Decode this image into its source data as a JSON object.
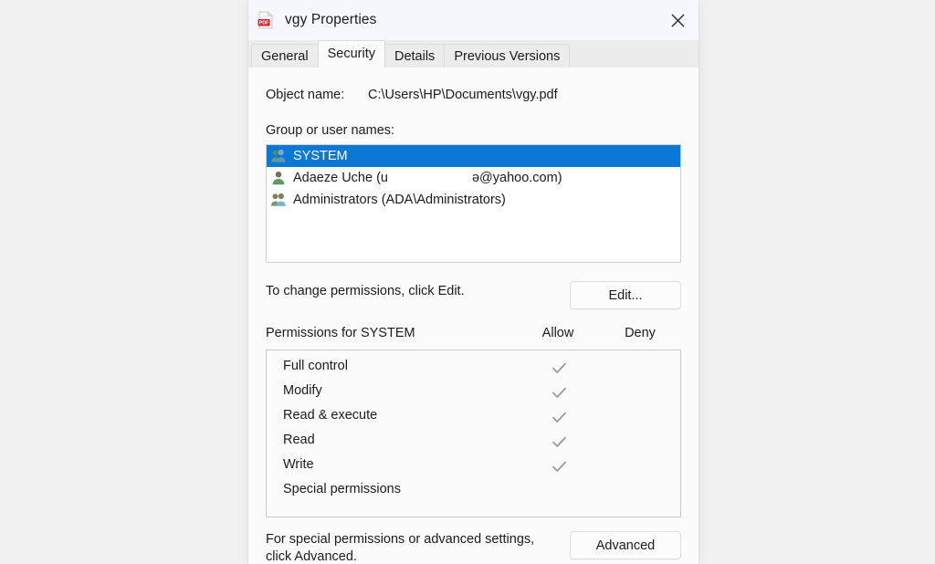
{
  "window": {
    "title": "vgy Properties",
    "icon": "pdf-file-icon",
    "close_label": "✕"
  },
  "tabs": [
    {
      "label": "General",
      "active": false
    },
    {
      "label": "Security",
      "active": true
    },
    {
      "label": "Details",
      "active": false
    },
    {
      "label": "Previous Versions",
      "active": false
    }
  ],
  "security": {
    "object_name_label": "Object name:",
    "object_name_value": "C:\\Users\\HP\\Documents\\vgy.pdf",
    "group_label": "Group or user names:",
    "users": [
      {
        "name": "SYSTEM",
        "icon": "group-users-icon",
        "selected": true
      },
      {
        "name_before": "Adaeze Uche (u",
        "name_after": "ə@yahoo.com)",
        "icon": "single-user-icon",
        "selected": false,
        "redacted": true
      },
      {
        "name": "Administrators (ADA\\Administrators)",
        "icon": "group-users-icon",
        "selected": false
      }
    ],
    "edit_hint": "To change permissions, click Edit.",
    "edit_button": "Edit...",
    "permissions_for": "Permissions for SYSTEM",
    "allow_header": "Allow",
    "deny_header": "Deny",
    "permissions": [
      {
        "name": "Full control",
        "allow": true,
        "deny": false
      },
      {
        "name": "Modify",
        "allow": true,
        "deny": false
      },
      {
        "name": "Read & execute",
        "allow": true,
        "deny": false
      },
      {
        "name": "Read",
        "allow": true,
        "deny": false
      },
      {
        "name": "Write",
        "allow": true,
        "deny": false
      },
      {
        "name": "Special permissions",
        "allow": false,
        "deny": false
      }
    ],
    "footer_hint": "For special permissions or advanced settings, click Advanced.",
    "advanced_button": "Advanced"
  },
  "colors": {
    "selection_blue": "#0a78d4",
    "check_gray": "#9a9a9a",
    "dialog_bg": "#fbfbfb",
    "titlebar_bg": "#f6f7fc",
    "pdf_red": "#e0202c"
  }
}
